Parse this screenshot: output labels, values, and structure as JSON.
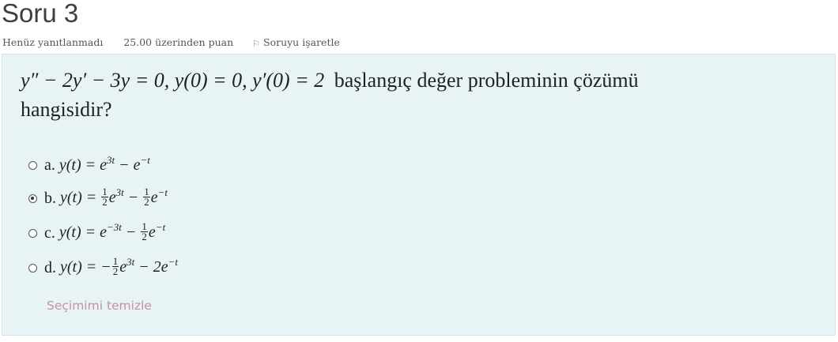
{
  "question": {
    "title": "Soru 3",
    "status": "Henüz yanıtlanmadı",
    "marks": "25.00 üzerinden puan",
    "flag_label": "Soruyu işaretle",
    "text_equation": "y″ − 2y′ − 3y = 0,  y(0) = 0,  y′(0) = 2",
    "text_words_line1": "başlangıç değer probleminin çözümü",
    "text_words_line2": "hangisidir?"
  },
  "answers": [
    {
      "letter": "a.",
      "lhs": "y(t) = ",
      "expr": "e^{3t} − e^{−t}",
      "selected": false
    },
    {
      "letter": "b.",
      "lhs": "y(t) = ",
      "expr": "(1/2)e^{3t} − (1/2)e^{−t}",
      "selected": true
    },
    {
      "letter": "c.",
      "lhs": "y(t) = ",
      "expr": "e^{−3t} − (1/2)e^{−t}",
      "selected": false
    },
    {
      "letter": "d.",
      "lhs": "y(t) = ",
      "expr": "−(1/2)e^{3t} − 2e^{−t}",
      "selected": false
    }
  ],
  "clear_choice_label": "Seçimimi temizle",
  "icons": {
    "flag": "flag-icon"
  },
  "colors": {
    "question_background": "#e7f3f5",
    "clear_link": "#c790a8"
  }
}
